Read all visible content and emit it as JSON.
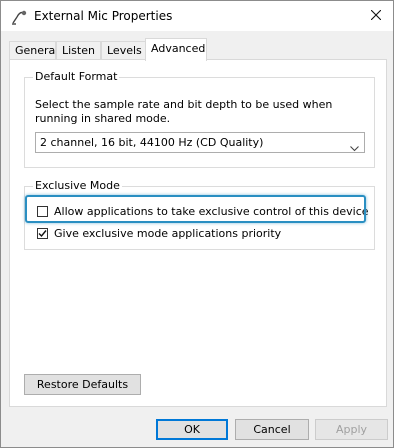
{
  "window": {
    "title": "External Mic Properties",
    "icons": {
      "app": "microphone-icon",
      "close": "close-icon"
    }
  },
  "tabs": [
    {
      "label": "General",
      "active": false
    },
    {
      "label": "Listen",
      "active": false
    },
    {
      "label": "Levels",
      "active": false
    },
    {
      "label": "Advanced",
      "active": true
    }
  ],
  "default_format": {
    "title": "Default Format",
    "description": "Select the sample rate and bit depth to be used when running in shared mode.",
    "selected_value": "2 channel, 16 bit, 44100 Hz (CD Quality)"
  },
  "exclusive_mode": {
    "title": "Exclusive Mode",
    "allow_label": "Allow applications to take exclusive control of this device",
    "allow_checked": false,
    "priority_label": "Give exclusive mode applications priority",
    "priority_checked": true
  },
  "buttons": {
    "restore_defaults": "Restore Defaults",
    "ok": "OK",
    "cancel": "Cancel",
    "apply": "Apply"
  },
  "colors": {
    "highlight": "#2a8fc2",
    "default_button_border": "#0078d7"
  }
}
